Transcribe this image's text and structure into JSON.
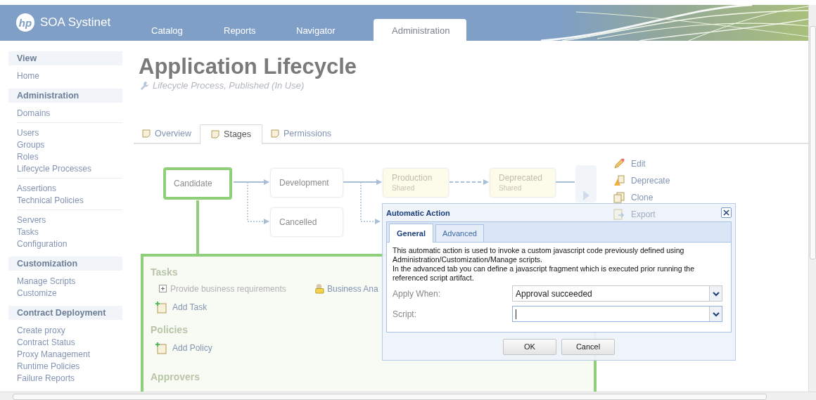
{
  "header": {
    "logo_mark": "hp",
    "brand": "SOA Systinet",
    "tabs": [
      {
        "label": "Catalog",
        "selected": false
      },
      {
        "label": "Reports",
        "selected": false
      },
      {
        "label": "Navigator",
        "selected": false
      },
      {
        "label": "Administration",
        "selected": true
      }
    ]
  },
  "sidebar": {
    "sections": [
      {
        "heading": "View",
        "groups": [
          [
            "Home"
          ]
        ]
      },
      {
        "heading": "Administration",
        "groups": [
          [
            "Domains"
          ],
          [
            "Users",
            "Groups",
            "Roles",
            "Lifecycle Processes"
          ],
          [
            "Assertions",
            "Technical Policies"
          ],
          [
            "Servers",
            "Tasks",
            "Configuration"
          ]
        ]
      },
      {
        "heading": "Customization",
        "groups": [
          [
            "Manage Scripts",
            "Customize"
          ]
        ]
      },
      {
        "heading": "Contract Deployment",
        "groups": [
          [
            "Create proxy",
            "Contract Status",
            "Proxy Management",
            "Runtime Policies",
            "Failure Reports"
          ]
        ]
      }
    ]
  },
  "page": {
    "title": "Application Lifecycle",
    "subtitle": "Lifecycle Process, Published (In Use)"
  },
  "tabs": [
    {
      "label": "Overview",
      "selected": false
    },
    {
      "label": "Stages",
      "selected": true
    },
    {
      "label": "Permissions",
      "selected": false
    }
  ],
  "stages": [
    {
      "name": "Candidate",
      "kind": "current"
    },
    {
      "name": "Development",
      "kind": "normal"
    },
    {
      "name": "Cancelled",
      "kind": "normal"
    },
    {
      "name": "Production",
      "sublabel": "Shared",
      "kind": "shared"
    },
    {
      "name": "Deprecated",
      "sublabel": "Shared",
      "kind": "shared"
    }
  ],
  "actions": [
    {
      "label": "Edit",
      "kind": "edit",
      "disabled": false
    },
    {
      "label": "Deprecate",
      "kind": "deprecate",
      "disabled": false
    },
    {
      "label": "Clone",
      "kind": "clone",
      "disabled": false
    },
    {
      "label": "Export",
      "kind": "export",
      "disabled": true
    }
  ],
  "stage_panel": {
    "tasks_heading": "Tasks",
    "tasks": [
      {
        "label": "Provide business requirements",
        "expanded": false,
        "assignee": "Business Ana"
      }
    ],
    "add_task": "Add Task",
    "policies_heading": "Policies",
    "add_policy": "Add Policy",
    "approvers_heading": "Approvers"
  },
  "dialog": {
    "title": "Automatic Action",
    "tabs": [
      {
        "label": "General",
        "selected": true
      },
      {
        "label": "Advanced",
        "selected": false
      }
    ],
    "description": [
      "This automatic action is used to invoke a custom javascript code previously defined using Administration/Customization/Manage scripts.",
      "In the advanced tab you can define a javascript fragment which is executed prior running the referenced script artifact."
    ],
    "fields": [
      {
        "label": "Apply When:",
        "value": "Approval succeeded",
        "focused": false
      },
      {
        "label": "Script:",
        "focused": true
      }
    ],
    "buttons": [
      "OK",
      "Cancel"
    ]
  }
}
